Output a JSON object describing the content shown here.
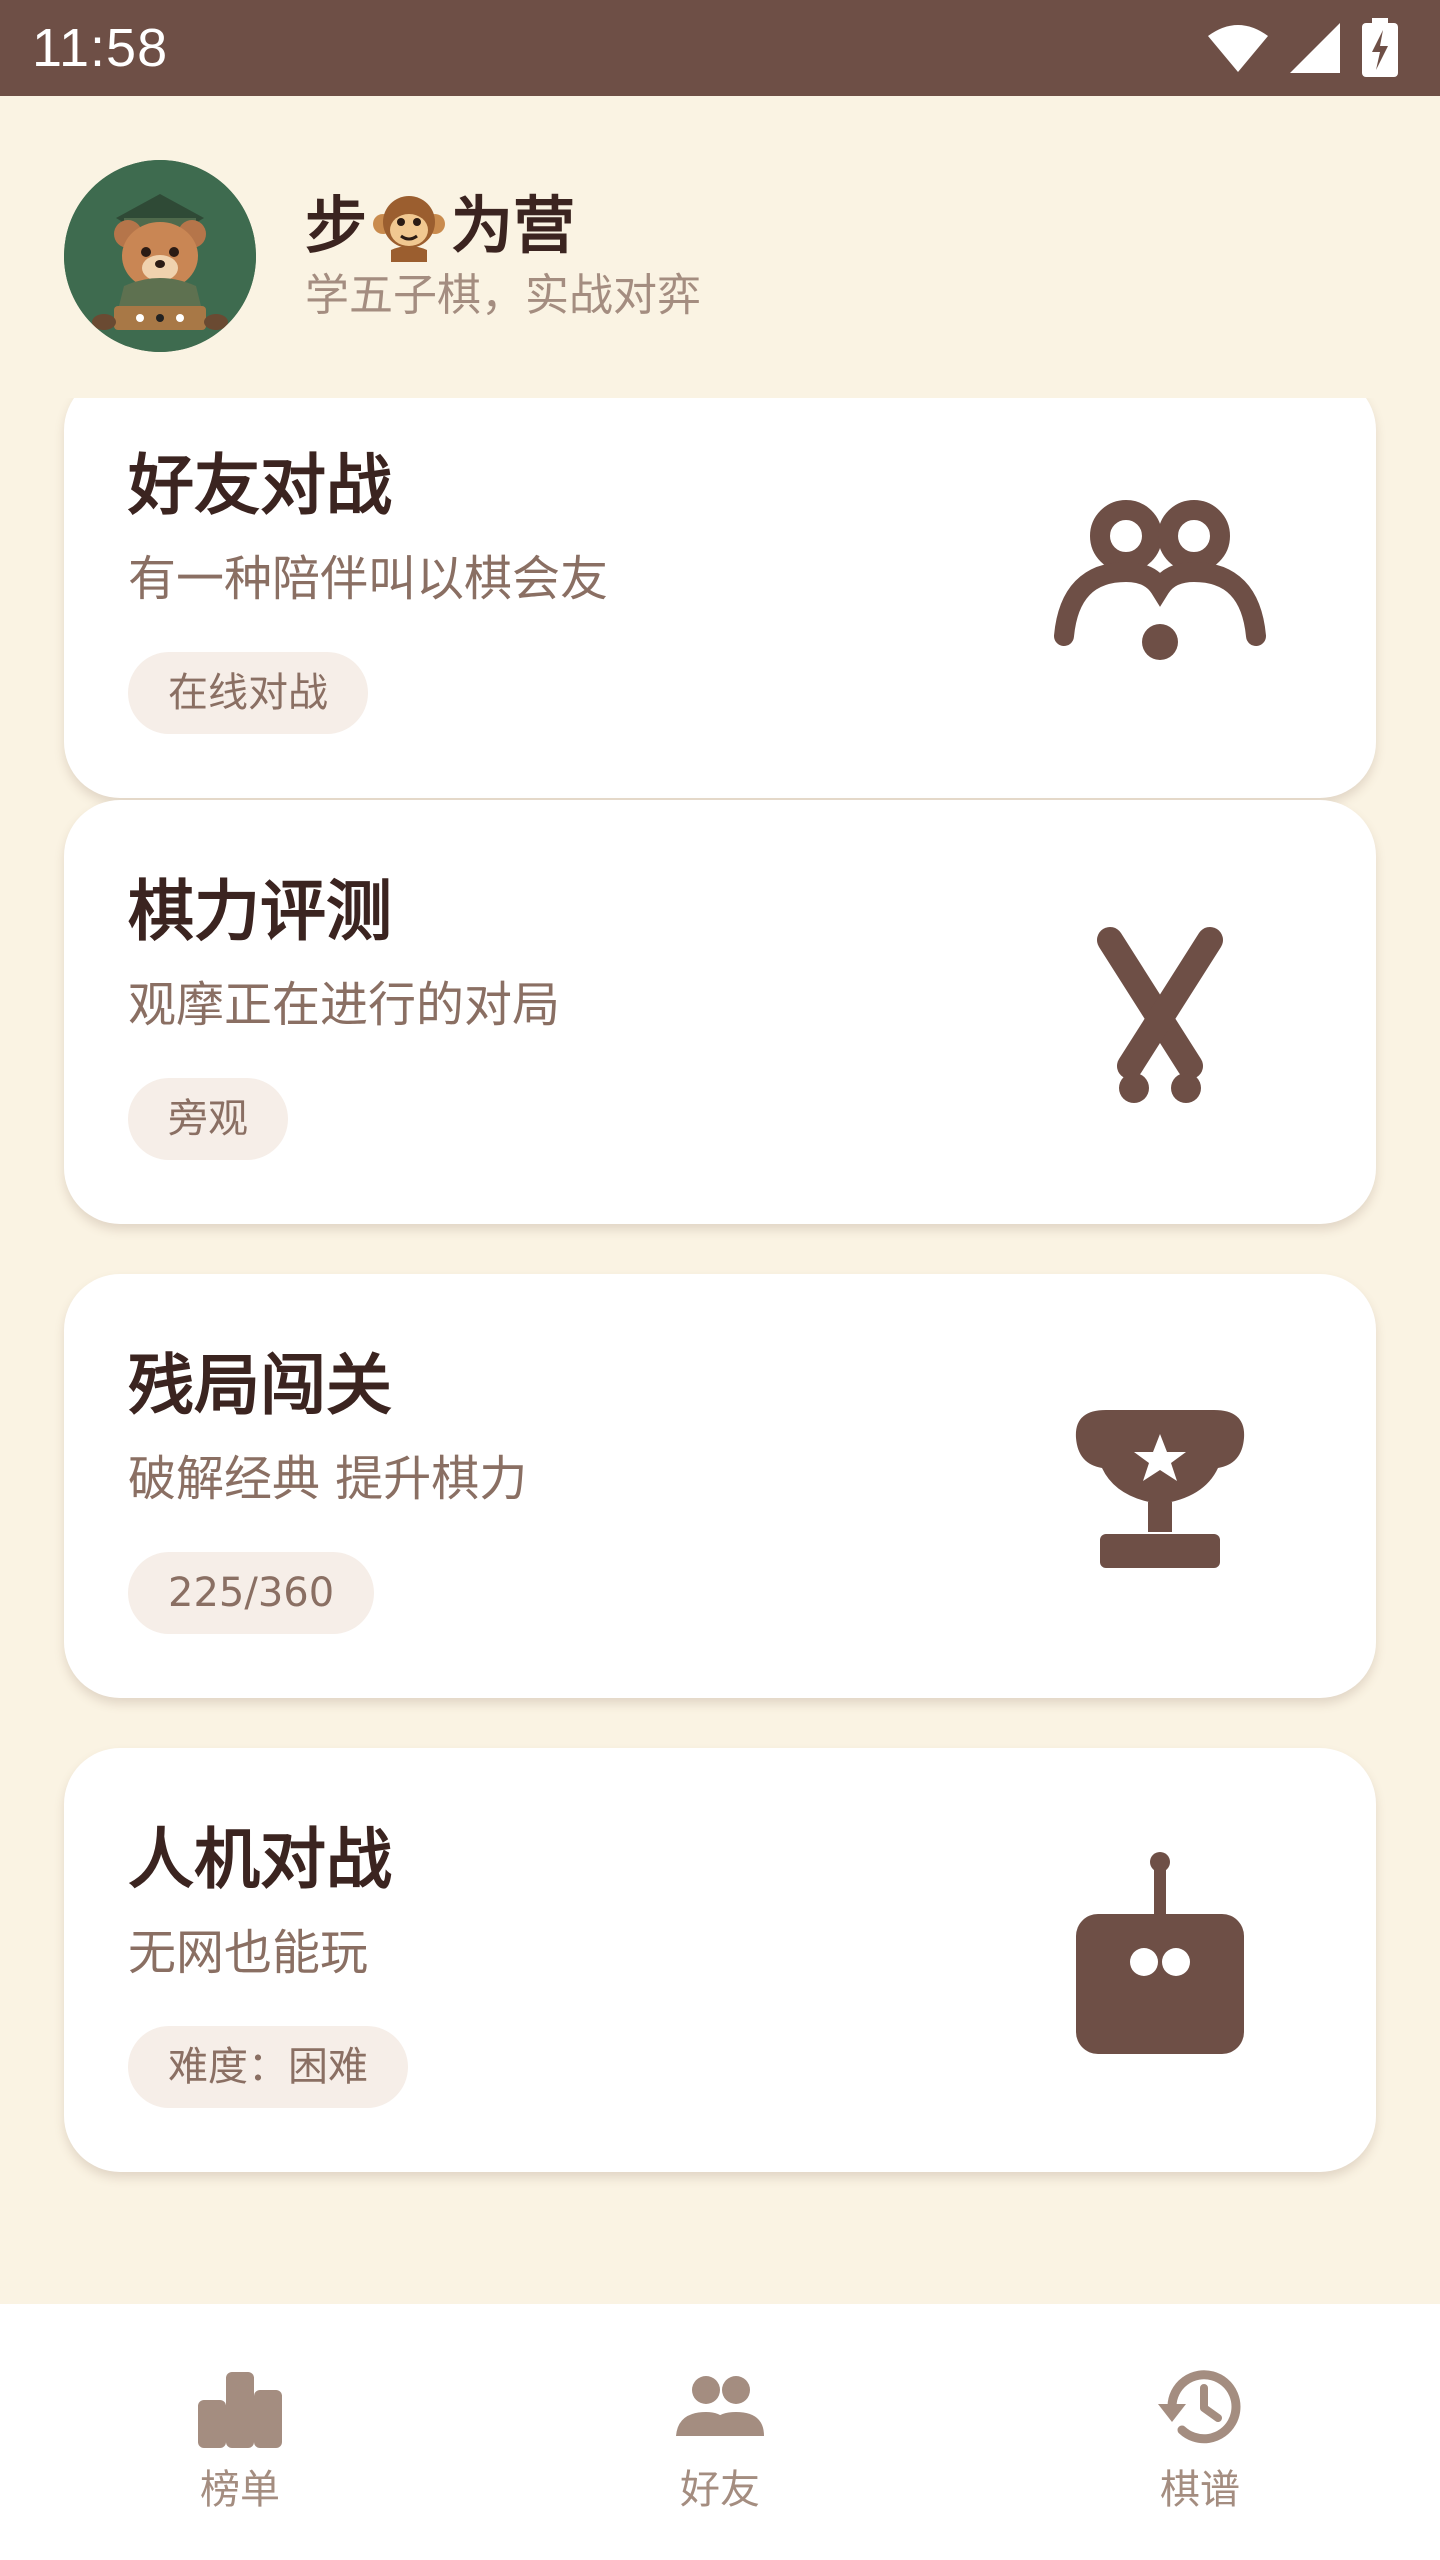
{
  "status_bar": {
    "time": "11:58",
    "icons": [
      "wifi-icon",
      "cellular-signal-icon",
      "battery-charging-icon"
    ]
  },
  "header": {
    "title_left": "步",
    "title_right": "为营",
    "subtitle": "学五子棋，实战对弈"
  },
  "cards": [
    {
      "title": "好友对战",
      "desc": "有一种陪伴叫以棋会友",
      "tag": "在线对战",
      "icon": "friends-icon"
    },
    {
      "title": "棋力评测",
      "desc": "观摩正在进行的对局",
      "tag": "旁观",
      "icon": "crossed-swords-icon"
    },
    {
      "title": "残局闯关",
      "desc": "破解经典 提升棋力",
      "tag": "225/360",
      "icon": "trophy-icon"
    },
    {
      "title": "人机对战",
      "desc": "无网也能玩",
      "tag": "难度：困难",
      "icon": "robot-icon"
    }
  ],
  "bottom_nav": [
    {
      "label": "榜单",
      "icon": "leaderboard-icon"
    },
    {
      "label": "好友",
      "icon": "people-icon"
    },
    {
      "label": "棋谱",
      "icon": "history-icon"
    }
  ],
  "colors": {
    "brand": "#6E4F46",
    "background": "#FAF3E3",
    "title": "#3B2420",
    "muted": "#A48D80"
  }
}
